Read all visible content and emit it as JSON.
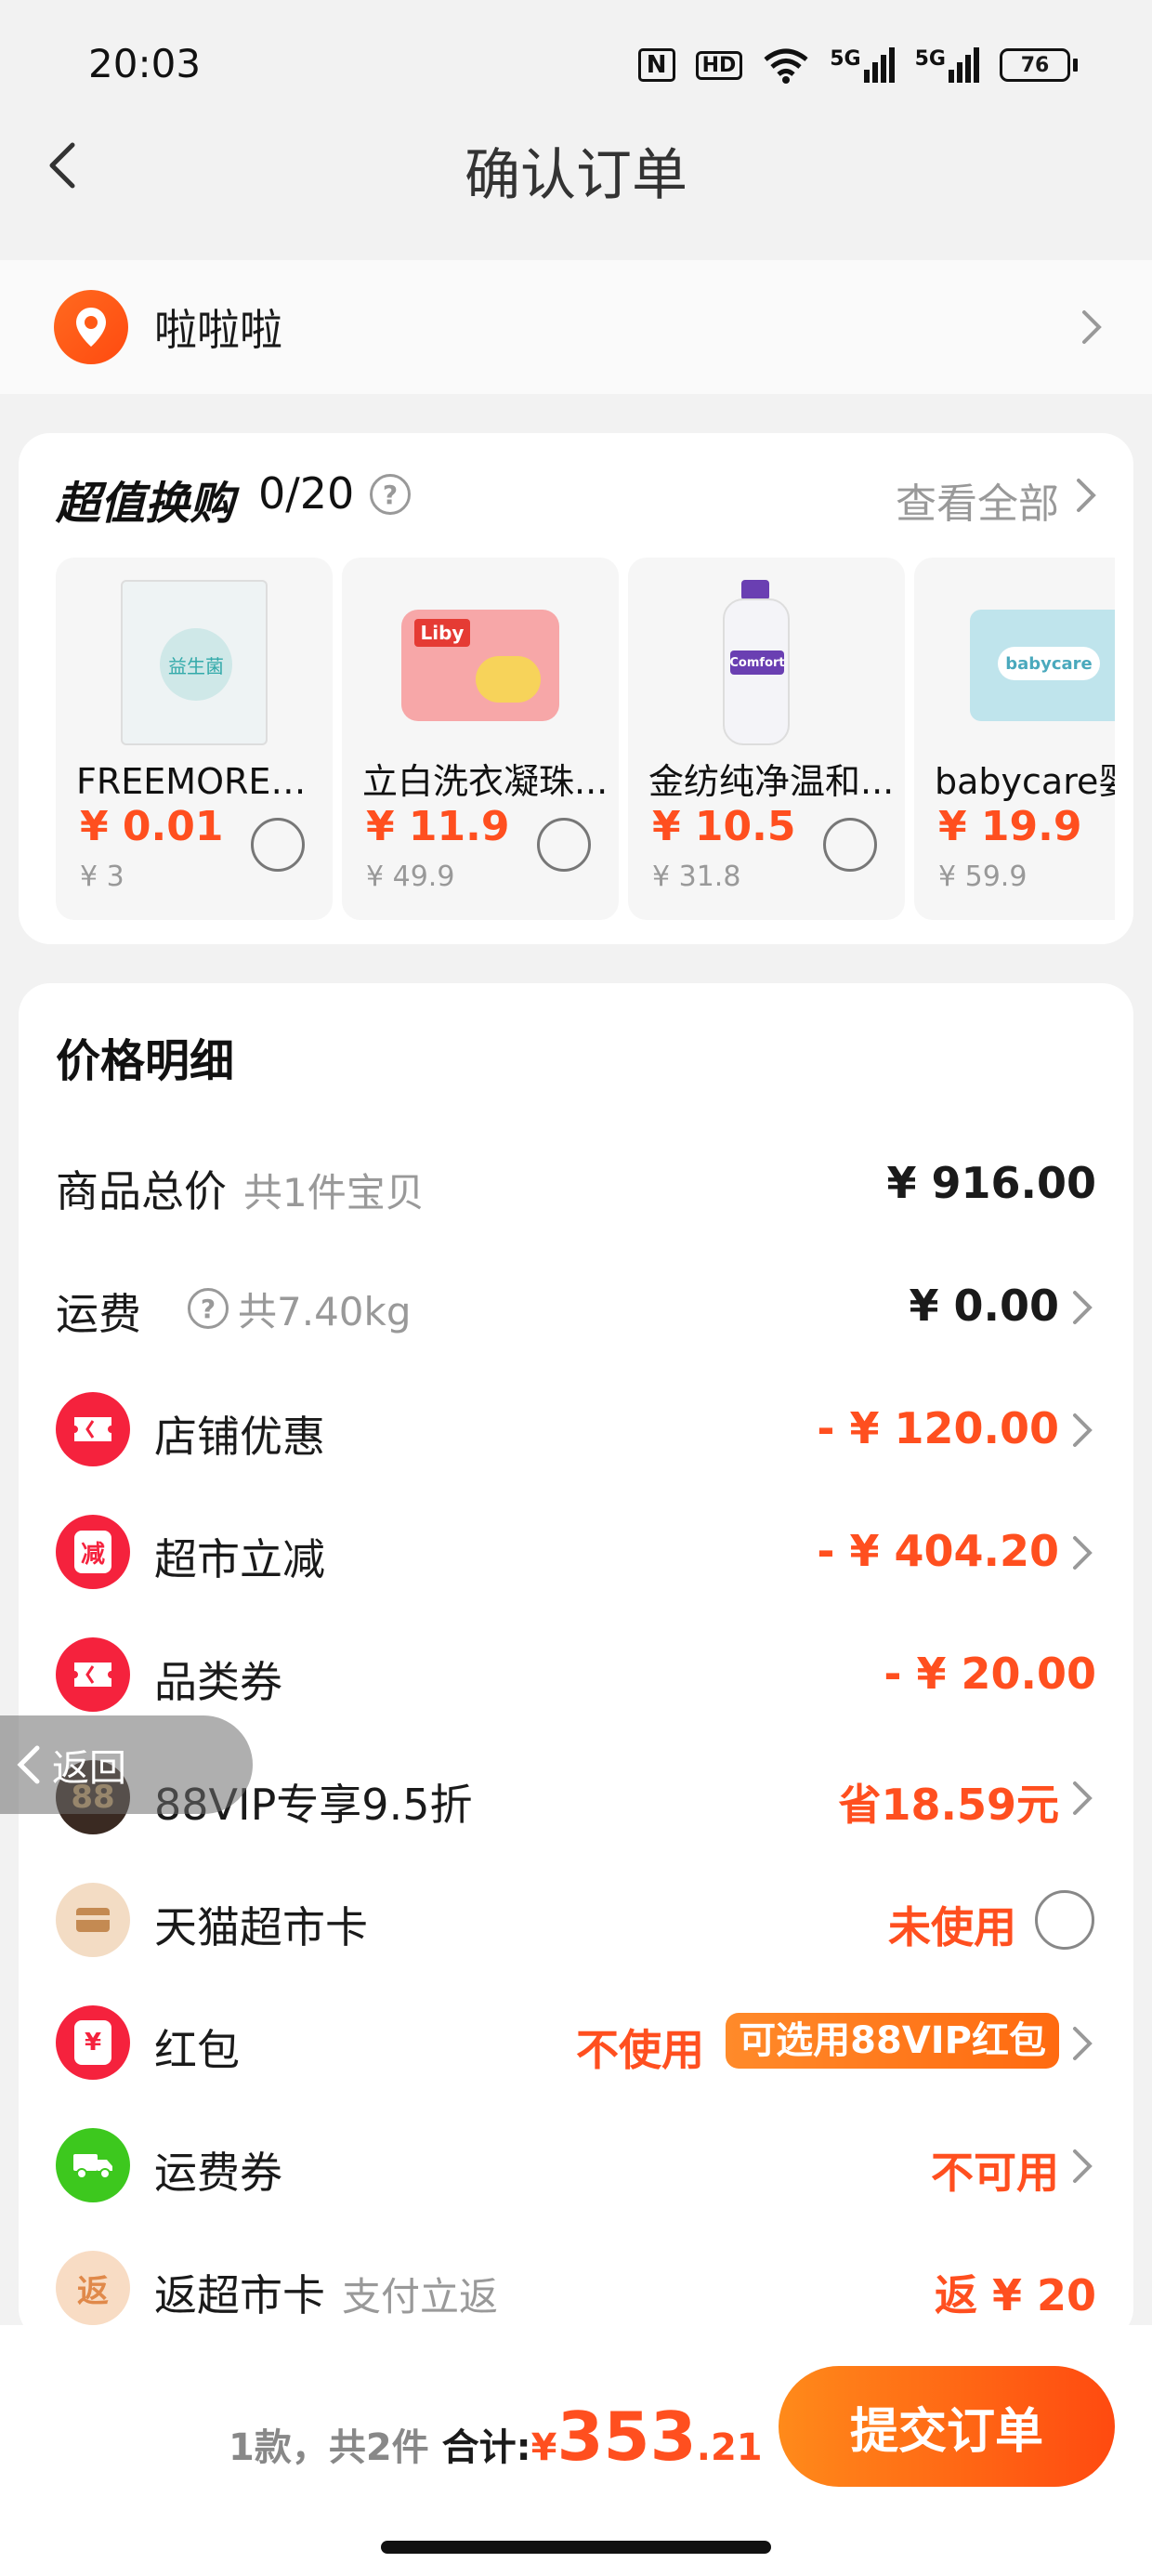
{
  "status_bar": {
    "time": "20:03",
    "nfc": "N",
    "hd": "HD",
    "signal1": "5G",
    "signal2": "5G",
    "battery": "76"
  },
  "nav": {
    "title": "确认订单"
  },
  "address": {
    "name": "啦啦啦"
  },
  "swap": {
    "title": "超值换购",
    "count": "0/20",
    "view_all": "查看全部",
    "products": [
      {
        "name": "FREEMORE自...",
        "price": "¥ 0.01",
        "orig": "¥ 3"
      },
      {
        "name": "立白洗衣凝珠...",
        "price": "¥ 11.9",
        "orig": "¥ 49.9"
      },
      {
        "name": "金纺纯净温和...",
        "price": "¥ 10.5",
        "orig": "¥ 31.8"
      },
      {
        "name": "babycare婴",
        "price": "¥ 19.9",
        "orig": "¥ 59.9"
      }
    ],
    "product_labels": [
      "益生菌",
      "Liby",
      "Comfort",
      "babycare"
    ]
  },
  "price": {
    "title": "价格明细",
    "rows": [
      {
        "label": "商品总价",
        "sub": "共1件宝贝",
        "value": "¥ 916.00"
      },
      {
        "label": "运费",
        "sub": "共7.40kg",
        "value": "¥ 0.00"
      },
      {
        "label": "店铺优惠",
        "value": "- ¥ 120.00"
      },
      {
        "label": "超市立减",
        "value": "- ¥ 404.20",
        "icon_text": "减"
      },
      {
        "label": "品类券",
        "value": "- ¥ 20.00"
      },
      {
        "label": "88VIP专享9.5折",
        "value": "省18.59元",
        "icon_text": "88"
      },
      {
        "label": "天猫超市卡",
        "value": "未使用"
      },
      {
        "label": "红包",
        "value": "不使用",
        "badge": "可选用88VIP红包",
        "icon_text": "¥"
      },
      {
        "label": "运费券",
        "value": "不可用"
      },
      {
        "label": "返超市卡",
        "sub": "支付立返",
        "value": "返 ¥ 20",
        "icon_text": "返"
      }
    ]
  },
  "float_back": {
    "label": "返回"
  },
  "bottom": {
    "count": "1款，共2件",
    "total_label": "合计:",
    "currency": "¥",
    "amount_int": "353",
    "amount_dec": ".21",
    "submit": "提交订单"
  }
}
